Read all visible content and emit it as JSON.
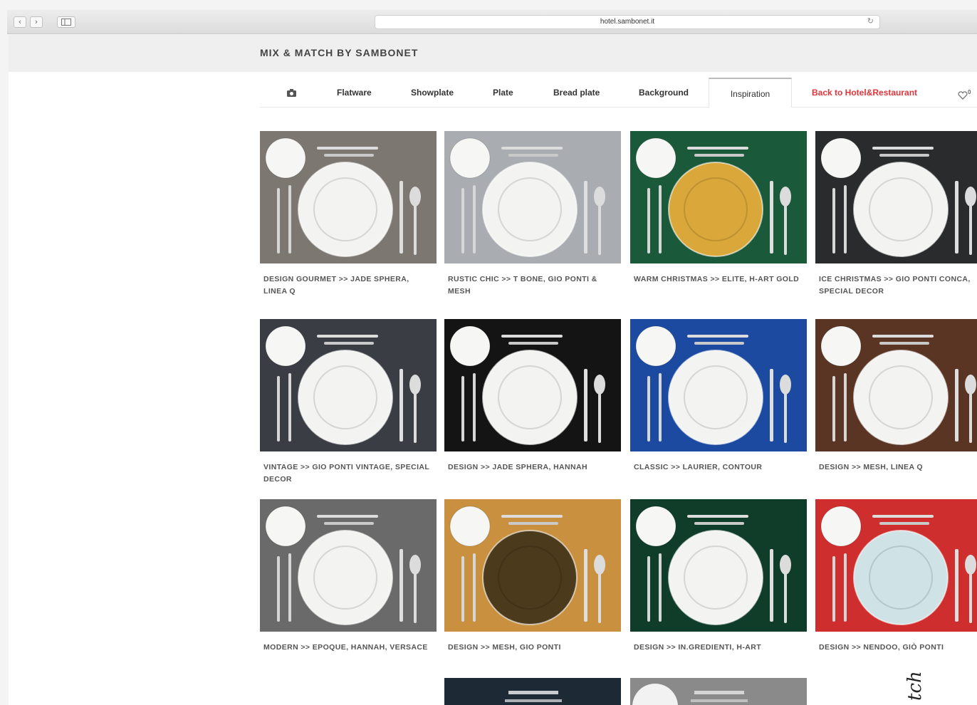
{
  "browser": {
    "url": "hotel.sambonet.it",
    "back_icon": "chevron-left-icon",
    "forward_icon": "chevron-right-icon",
    "sidebar_icon": "sidebar-icon",
    "reload_icon": "reload-icon"
  },
  "header": {
    "brand": "MIX & MATCH BY SAMBONET"
  },
  "menu": {
    "camera_icon": "camera-icon",
    "items": [
      {
        "label": "Flatware"
      },
      {
        "label": "Showplate"
      },
      {
        "label": "Plate"
      },
      {
        "label": "Bread plate"
      },
      {
        "label": "Background"
      },
      {
        "label": "Inspiration",
        "active": true
      }
    ],
    "back_link": "Back to Hotel&Restaurant",
    "back_color": "#e0353a",
    "wishlist_icon": "heart-icon",
    "wishlist_count": "0"
  },
  "gallery": {
    "items": [
      {
        "caption": "DESIGN GOURMET >> JADE SPHERA, LINEA Q",
        "bg": "#7d7772"
      },
      {
        "caption": "RUSTIC CHIC >> T BONE, GIO PONTI & MESH",
        "bg": "#a9adb1"
      },
      {
        "caption": "WARM CHRISTMAS >> ELITE, H-ART GOLD",
        "bg": "#1a5a3a"
      },
      {
        "caption": "ICE CHRISTMAS >> GIO PONTI CONCA, SPECIAL DECOR",
        "bg": "#2a2b2d"
      },
      {
        "caption": "VINTAGE >> GIO PONTI VINTAGE, SPECIAL DECOR",
        "bg": "#3a3d44"
      },
      {
        "caption": "DESIGN >> JADE SPHERA, HANNAH",
        "bg": "#141414"
      },
      {
        "caption": "CLASSIC >> LAURIER, CONTOUR",
        "bg": "#1c4aa0"
      },
      {
        "caption": "DESIGN >> MESH, LINEA Q",
        "bg": "#5a3524"
      },
      {
        "caption": "MODERN >> EPOQUE, HANNAH, VERSACE",
        "bg": "#6a6a6a"
      },
      {
        "caption": "DESIGN >> MESH, GIO PONTI",
        "bg": "#c8903f"
      },
      {
        "caption": "DESIGN >> IN.GREDIENTI, H-ART",
        "bg": "#0f3d2a"
      },
      {
        "caption": "DESIGN >> NENDOO, GIÒ PONTI",
        "bg": "#cf2e2e"
      }
    ]
  },
  "side_text": "tch"
}
